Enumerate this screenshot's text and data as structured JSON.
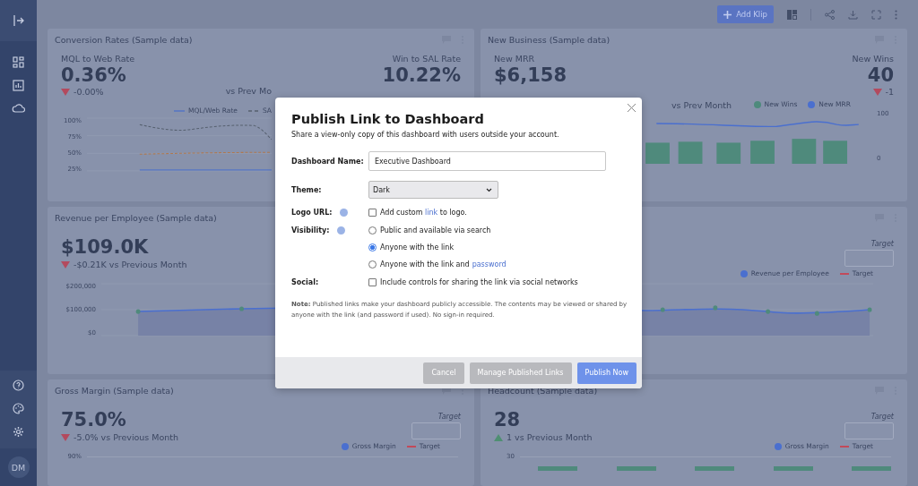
{
  "sidebar": {
    "avatar": "DM"
  },
  "toolbar": {
    "add_button": "Add Klip"
  },
  "conversion": {
    "title": "Conversion Rates (Sample data)",
    "metrics": [
      {
        "label": "MQL to Web Rate",
        "value": "0.36%",
        "delta": "-0.00%",
        "declined": true
      },
      {
        "label": "Win to SAL Rate",
        "value": "10.22%"
      }
    ],
    "comparison": "vs Prev Mo",
    "legend": [
      {
        "label": "MQL/Web Rate",
        "kind": "line",
        "color": "#5474c4"
      },
      {
        "label": "SA",
        "kind": "dashed",
        "color": "#56606f"
      }
    ],
    "yaxis": [
      "100%",
      "75%",
      "50%",
      "25%"
    ]
  },
  "new_business": {
    "title": "New Business (Sample data)",
    "metrics": [
      {
        "label": "New MRR",
        "value": "$6,158"
      },
      {
        "label": "New Wins",
        "value": "40",
        "delta": "-1",
        "declined": true
      }
    ],
    "comparison": "vs Prev Month",
    "legend": [
      {
        "label": "New Wins",
        "kind": "dot",
        "color": "#4e8a7c"
      },
      {
        "label": "New MRR",
        "kind": "dot",
        "color": "#4a6fcf"
      }
    ],
    "yaxis": [
      "100",
      "0"
    ]
  },
  "revenue": {
    "title": "Revenue per Employee (Sample data)",
    "value": "$109.0K",
    "delta": "-$0.21K vs Previous Month",
    "declined": true,
    "target_label": "Target",
    "legend": [
      {
        "label": "Revenue per Employee",
        "kind": "dot",
        "color": "#4a6fcf"
      },
      {
        "label": "Target",
        "kind": "dashed",
        "color": "#c24a5a"
      }
    ],
    "yaxis": [
      "$200,000",
      "$100,000",
      "$0"
    ]
  },
  "bottom_cards": [
    {
      "title": "Gross Margin (Sample data)",
      "value": "75.0%",
      "delta": "-5.0% vs Previous Month",
      "declined": true,
      "target_label": "Target",
      "legend": [
        {
          "label": "Gross Margin",
          "kind": "dot",
          "color": "#4a6fcf"
        },
        {
          "label": "Target",
          "kind": "dashed",
          "color": "#c24a5a"
        }
      ],
      "yaxis": [
        "90%"
      ]
    },
    {
      "title": "Headcount (Sample data)",
      "value": "28",
      "delta": "1 vs Previous Month",
      "declined": false,
      "target_label": "Target",
      "legend": [
        {
          "label": "Gross Margin",
          "kind": "dot",
          "color": "#4a6fcf"
        },
        {
          "label": "Target",
          "kind": "dashed",
          "color": "#c24a5a"
        }
      ],
      "yaxis": [
        "30"
      ]
    }
  ],
  "modal": {
    "title": "Publish Link to Dashboard",
    "subtitle": "Share a view-only copy of this dashboard with users outside your account.",
    "name_label": "Dashboard Name:",
    "name_value": "Executive Dashboard",
    "theme_label": "Theme:",
    "theme_value": "Dark",
    "logo_label": "Logo URL:",
    "logo_option": {
      "before": "Add custom",
      "link": "link",
      "after": "to logo.",
      "checked": false
    },
    "visibility_label": "Visibility:",
    "visibility_options": [
      {
        "text": "Public and available via search",
        "selected": false
      },
      {
        "text": "Anyone with the link",
        "selected": true
      },
      {
        "text": "Anyone with the link and",
        "link": "password",
        "selected": false
      }
    ],
    "social_label": "Social:",
    "social_option": {
      "text": "Include controls for sharing the link via social networks",
      "checked": false
    },
    "note": "**Note:** Published links make your dashboard publicly accessible. The contents may be viewed or shared by anyone with the link (and password if used). No sign-in required.",
    "buttons": [
      {
        "label": "Cancel",
        "kind": "secondary"
      },
      {
        "label": "Manage Published Links",
        "kind": "secondary"
      },
      {
        "label": "Publish Now",
        "kind": "primary"
      }
    ]
  }
}
